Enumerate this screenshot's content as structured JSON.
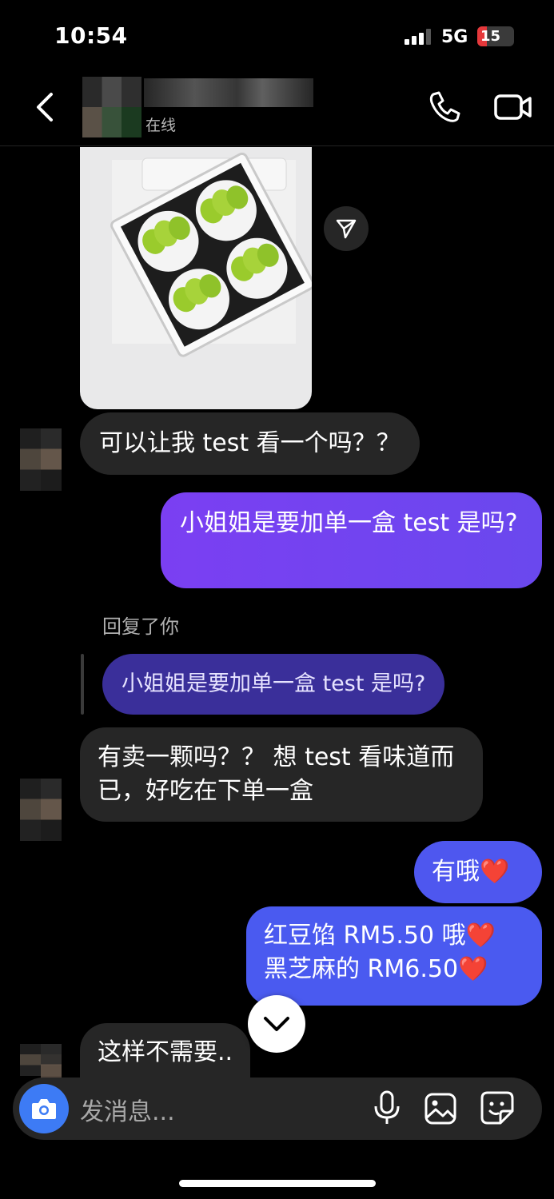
{
  "status_bar": {
    "time": "10:54",
    "network": "5G",
    "battery": "15"
  },
  "header": {
    "status": "在线"
  },
  "messages": {
    "incoming_1": "可以让我 test 看一个吗？？",
    "outgoing_1": "小姐姐是要加单一盒 test 是吗?",
    "reply_label": "回复了你",
    "quoted": "小姐姐是要加单一盒 test 是吗?",
    "incoming_2": "有卖一颗吗？？ 想 test 看味道而已，好吃在下单一盒",
    "outgoing_2": "有哦❤️",
    "outgoing_3_line1": "红豆馅 RM5.50 哦❤️",
    "outgoing_3_line2": "黑芝麻的 RM6.50❤️",
    "incoming_3": "这样不需要.."
  },
  "composer": {
    "placeholder": "发消息..."
  },
  "colors": {
    "outgoing_start": "#7b3ff2",
    "outgoing_end": "#4a5af0",
    "camera_button": "#3d7bf5",
    "incoming_bubble": "#262626"
  }
}
